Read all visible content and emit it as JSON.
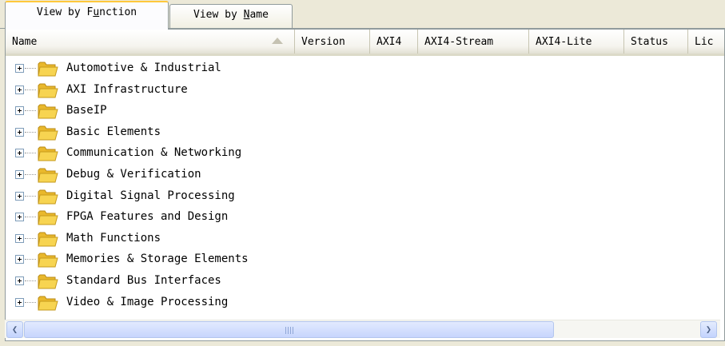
{
  "tabs": [
    {
      "pre": "View by F",
      "mnemonic": "u",
      "post": "nction",
      "active": true
    },
    {
      "pre": "View by ",
      "mnemonic": "N",
      "post": "ame",
      "active": false
    }
  ],
  "columns": [
    {
      "label": "Name",
      "sorted": "ascending"
    },
    {
      "label": "Version"
    },
    {
      "label": "AXI4"
    },
    {
      "label": "AXI4-Stream"
    },
    {
      "label": "AXI4-Lite"
    },
    {
      "label": "Status"
    },
    {
      "label": "Lic"
    }
  ],
  "tree": [
    "Automotive & Industrial",
    "AXI Infrastructure",
    "BaseIP",
    "Basic Elements",
    "Communication & Networking",
    "Debug & Verification",
    "Digital Signal Processing",
    "FPGA Features and Design",
    "Math Functions",
    "Memories & Storage Elements",
    "Standard Bus Interfaces",
    "Video & Image Processing"
  ],
  "icons": {
    "expand": "plus-box-icon",
    "folder": "folder-icon",
    "scroll_left": "arrow-left-icon",
    "scroll_right": "arrow-right-icon"
  },
  "colors": {
    "tab_accent": "#ffc83c",
    "folder_fill": "#f7d451",
    "scrollbar": "#c3d3fd"
  }
}
